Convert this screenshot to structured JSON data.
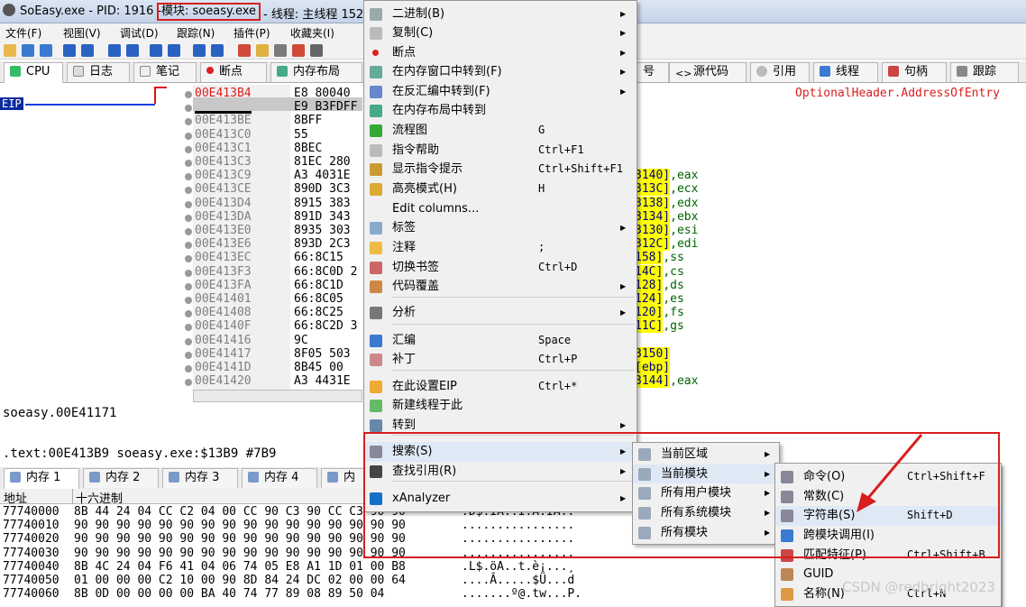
{
  "window": {
    "title_prefix": "SoEasy.exe - PID: 1916 -",
    "module": "模块: soeasy.exe",
    "title_suffix": "- 线程: 主线程 1520"
  },
  "menubar": [
    "文件(F)",
    "视图(V)",
    "调试(D)",
    "跟踪(N)",
    "插件(P)",
    "收藏夹(I)"
  ],
  "tabs": [
    "CPU",
    "日志",
    "笔记",
    "断点",
    "内存布局",
    "号",
    "源代码",
    "引用",
    "线程",
    "句柄",
    "跟踪"
  ],
  "eip_label": "EIP",
  "disasm": {
    "addresses": [
      "00E413B4",
      "00E413B9",
      "00E413BE",
      "00E413C0",
      "00E413C1",
      "00E413C3",
      "00E413C9",
      "00E413CE",
      "00E413D4",
      "00E413DA",
      "00E413E0",
      "00E413E6",
      "00E413EC",
      "00E413F3",
      "00E413FA",
      "00E41401",
      "00E41408",
      "00E4140F",
      "00E41416",
      "00E41417",
      "00E4141D",
      "00E41420"
    ],
    "hex": [
      "E8 80040",
      "E9 B3FDFF",
      "8BFF",
      "55",
      "8BEC",
      "81EC 280",
      "A3 4031E",
      "890D 3C3",
      "8915 383",
      "891D 343",
      "8935 303",
      "893D 2C3",
      "66:8C15",
      "66:8C0D 2",
      "66:8C1D",
      "66:8C05",
      "66:8C25",
      "66:8C2D 3",
      "9C",
      "8F05 503",
      "8B45 00",
      "A3 4431E"
    ],
    "right": [
      [
        "",
        "OptionalHeader.AddressOfEntry"
      ],
      [
        "",
        ""
      ],
      [
        "",
        ""
      ],
      [
        "",
        ""
      ],
      [
        "",
        ""
      ],
      [
        "",
        ""
      ],
      [
        "3140]",
        ",eax"
      ],
      [
        "313C]",
        ",ecx"
      ],
      [
        "3138]",
        ",edx"
      ],
      [
        "3134]",
        ",ebx"
      ],
      [
        "3130]",
        ",esi"
      ],
      [
        "312C]",
        ",edi"
      ],
      [
        "158]",
        ",ss"
      ],
      [
        "14C]",
        ",cs"
      ],
      [
        "128]",
        ",ds"
      ],
      [
        "124]",
        ",es"
      ],
      [
        "120]",
        ",fs"
      ],
      [
        "11C]",
        ",gs"
      ],
      [
        "",
        ""
      ],
      [
        "3150]",
        ""
      ],
      [
        "[ebp]",
        ""
      ],
      [
        "3144]",
        ",eax"
      ]
    ]
  },
  "info": {
    "line1": "soeasy.00E41171",
    "line2": ".text:00E413B9 soeasy.exe:$13B9 #7B9"
  },
  "dump": {
    "tabs": [
      "内存 1",
      "内存 2",
      "内存 3",
      "内存 4",
      "内"
    ],
    "col_addr": "地址",
    "col_hex": "十六进制",
    "rows": [
      [
        "77740000",
        "8B 44 24 04 CC C2 04 00 CC 90 C3 90 CC C3 90 90",
        ".D$.ÌÂ..Ì.Ã.ÌÃ.."
      ],
      [
        "77740010",
        "90 90 90 90 90 90 90 90 90 90 90 90 90 90 90 90",
        "................"
      ],
      [
        "77740020",
        "90 90 90 90 90 90 90 90 90 90 90 90 90 90 90 90",
        "................"
      ],
      [
        "77740030",
        "90 90 90 90 90 90 90 90 90 90 90 90 90 90 90 90",
        "................"
      ],
      [
        "77740040",
        "8B 4C 24 04 F6 41 04 06 74 05 E8 A1 1D 01 00 B8",
        ".L$.öA..t.è¡...¸"
      ],
      [
        "77740050",
        "01 00 00 00 C2 10 00 90 8D 84 24 DC 02 00 00 64",
        "....Â.....$Ü...d"
      ],
      [
        "77740060",
        "8B 0D 00 00 00 00 BA 40 74 77 89 08 89 50 04",
        ".......º@.tw...P."
      ]
    ]
  },
  "context_menu": [
    {
      "label": "二进制(B)",
      "shortcut": "",
      "arrow": true,
      "icon": "binary-icon"
    },
    {
      "label": "复制(C)",
      "shortcut": "",
      "arrow": true,
      "icon": "copy-icon"
    },
    {
      "label": "断点",
      "shortcut": "",
      "arrow": true,
      "icon": "breakpoint-icon"
    },
    {
      "label": "在内存窗口中转到(F)",
      "shortcut": "",
      "arrow": true,
      "icon": "memory-icon"
    },
    {
      "label": "在反汇编中转到(F)",
      "shortcut": "",
      "arrow": true,
      "icon": "disasm-icon"
    },
    {
      "label": "在内存布局中转到",
      "shortcut": "",
      "arrow": false,
      "icon": "map-icon"
    },
    {
      "label": "流程图",
      "shortcut": "G",
      "arrow": false,
      "icon": "graph-icon"
    },
    {
      "label": "指令帮助",
      "shortcut": "Ctrl+F1",
      "arrow": false,
      "icon": "help-icon"
    },
    {
      "label": "显示指令提示",
      "shortcut": "Ctrl+Shift+F1",
      "arrow": false,
      "icon": "tip-icon"
    },
    {
      "label": "高亮模式(H)",
      "shortcut": "H",
      "arrow": false,
      "icon": "highlight-icon"
    },
    {
      "label": "Edit columns...",
      "shortcut": "",
      "arrow": false,
      "icon": ""
    },
    {
      "label": "标签",
      "shortcut": "",
      "arrow": true,
      "icon": "label-icon"
    },
    {
      "label": "注释",
      "shortcut": ";",
      "arrow": false,
      "icon": "comment-icon"
    },
    {
      "label": "切换书签",
      "shortcut": "Ctrl+D",
      "arrow": false,
      "icon": "bookmark-icon"
    },
    {
      "label": "代码覆盖",
      "shortcut": "",
      "arrow": true,
      "icon": "coverage-icon"
    },
    {
      "label": "分析",
      "shortcut": "",
      "arrow": true,
      "icon": "analyze-icon"
    },
    {
      "label": "汇编",
      "shortcut": "Space",
      "arrow": false,
      "icon": "assemble-icon"
    },
    {
      "label": "补丁",
      "shortcut": "Ctrl+P",
      "arrow": false,
      "icon": "patch-icon"
    },
    {
      "label": "在此设置EIP",
      "shortcut": "Ctrl+*",
      "arrow": false,
      "icon": "eip-icon"
    },
    {
      "label": "新建线程于此",
      "shortcut": "",
      "arrow": false,
      "icon": "thread-icon"
    },
    {
      "label": "转到",
      "shortcut": "",
      "arrow": true,
      "icon": "goto-icon"
    },
    {
      "label": "搜索(S)",
      "shortcut": "",
      "arrow": true,
      "icon": "search-icon"
    },
    {
      "label": "查找引用(R)",
      "shortcut": "",
      "arrow": true,
      "icon": "references-icon"
    },
    {
      "label": "xAnalyzer",
      "shortcut": "",
      "arrow": true,
      "icon": "xanalyzer-icon"
    }
  ],
  "search_submenu": [
    "当前区域",
    "当前模块",
    "所有用户模块",
    "所有系统模块",
    "所有模块"
  ],
  "module_submenu": [
    {
      "label": "命令(O)",
      "shortcut": "Ctrl+Shift+F"
    },
    {
      "label": "常数(C)",
      "shortcut": ""
    },
    {
      "label": "字符串(S)",
      "shortcut": "Shift+D"
    },
    {
      "label": "跨模块调用(I)",
      "shortcut": ""
    },
    {
      "label": "匹配特征(P)",
      "shortcut": "Ctrl+Shift+B"
    },
    {
      "label": "GUID",
      "shortcut": ""
    },
    {
      "label": "名称(N)",
      "shortcut": "Ctrl+N"
    }
  ],
  "watermark": "CSDN @redbright2023",
  "colors": {
    "accent_red": "#d81e1e",
    "selection": "#dfe8f5",
    "eip": "#0a2a9e"
  }
}
